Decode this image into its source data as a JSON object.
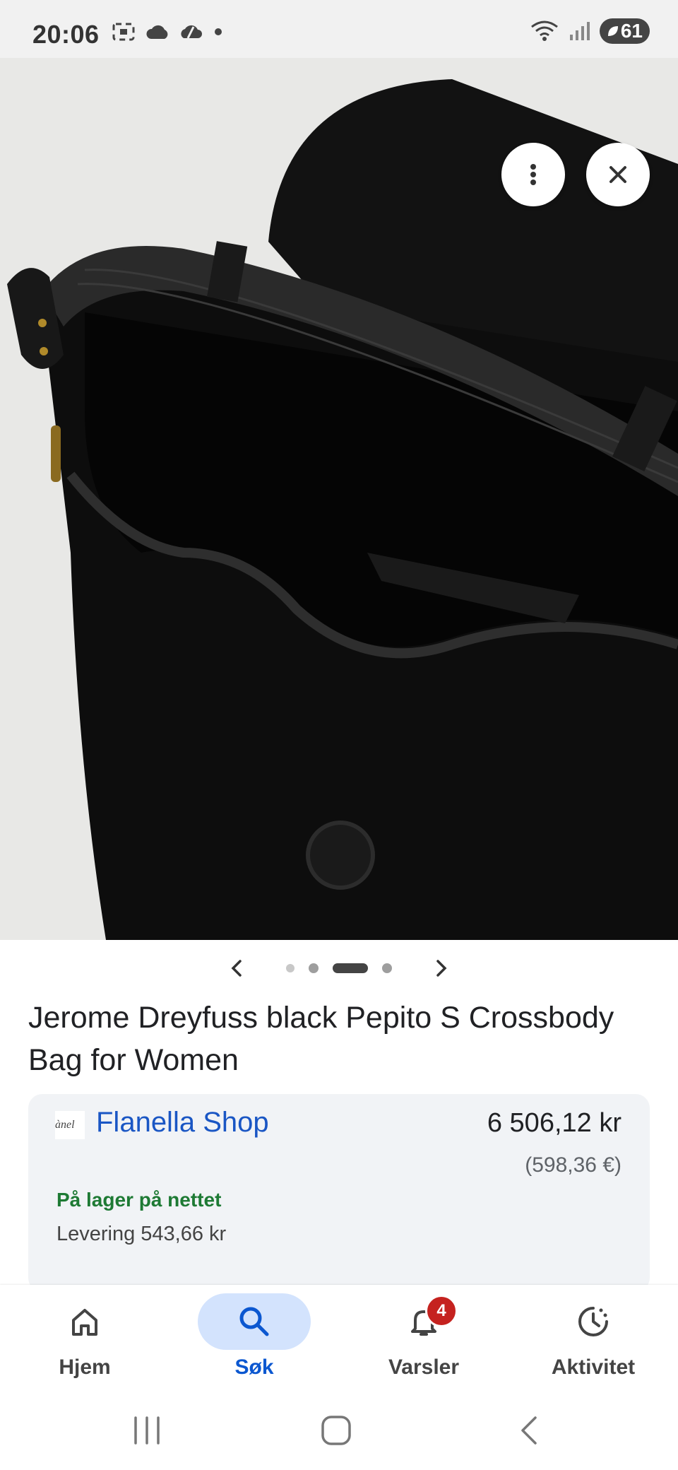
{
  "status_bar": {
    "time": "20:06",
    "battery": "61"
  },
  "product": {
    "title": "Jerome Dreyfuss black Pepito S Crossbody Bag for Women"
  },
  "carousel": {
    "dot_count": 4,
    "active_index": 2
  },
  "offer": {
    "shop_logo_text": "ànel",
    "shop_name": "Flanella Shop",
    "price": "6 506,12 kr",
    "price_eur": "(598,36 €)",
    "stock": "På lager på nettet",
    "delivery": "Levering 543,66 kr"
  },
  "bottom_nav": {
    "items": [
      {
        "label": "Hjem",
        "icon": "home-icon",
        "active": false
      },
      {
        "label": "Søk",
        "icon": "search-icon",
        "active": true
      },
      {
        "label": "Varsler",
        "icon": "bell-icon",
        "active": false,
        "badge": "4"
      },
      {
        "label": "Aktivitet",
        "icon": "activity-icon",
        "active": false
      }
    ]
  },
  "colors": {
    "accent": "#0b57d0",
    "link": "#1a56c4",
    "stock": "#1e7a34",
    "badge": "#c5221f",
    "active_pill": "#d3e3fd"
  }
}
